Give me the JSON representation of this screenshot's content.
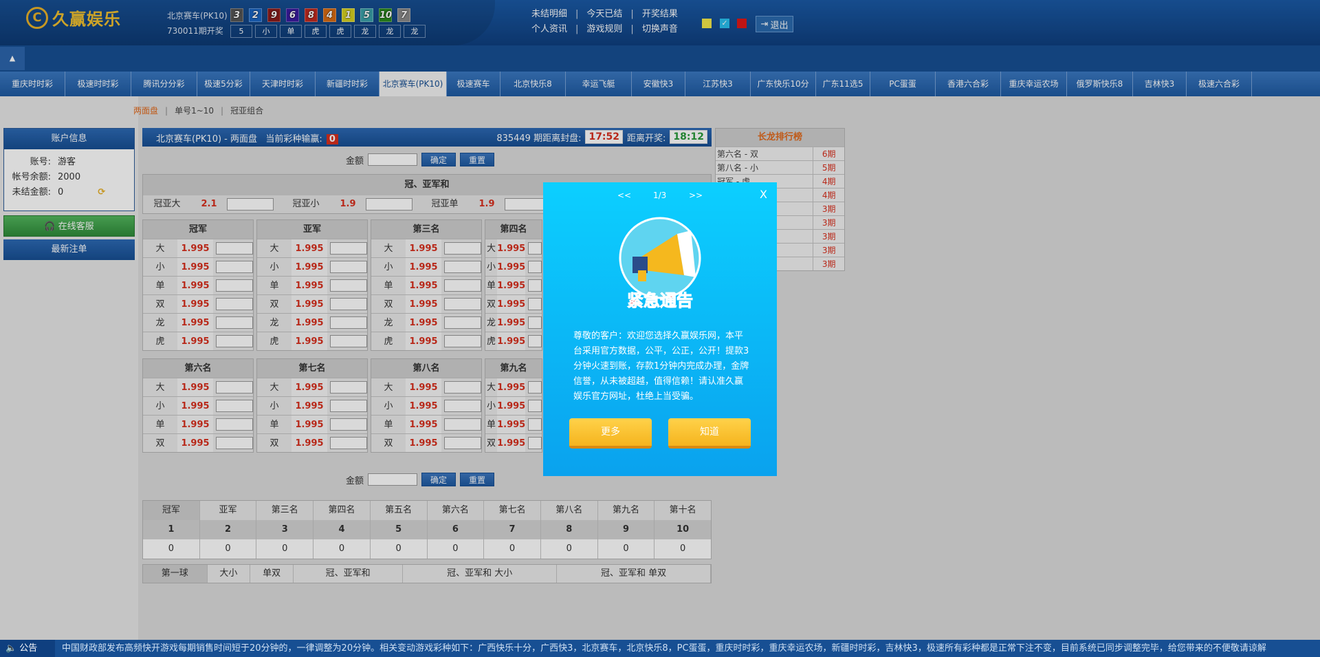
{
  "header": {
    "logo_text": "久赢娱乐",
    "lottery_name": "北京赛车(PK10)",
    "issue": "730011期开奖",
    "balls": [
      {
        "n": "3",
        "c": "#555555"
      },
      {
        "n": "2",
        "c": "#1a66c4"
      },
      {
        "n": "9",
        "c": "#8a1a1a"
      },
      {
        "n": "6",
        "c": "#3a1aa0"
      },
      {
        "n": "8",
        "c": "#c0281e"
      },
      {
        "n": "4",
        "c": "#d86a12"
      },
      {
        "n": "1",
        "c": "#d6d020"
      },
      {
        "n": "5",
        "c": "#3aa0a8"
      },
      {
        "n": "10",
        "c": "#2a8a1e"
      },
      {
        "n": "7",
        "c": "#8a8a8a"
      }
    ],
    "cells": [
      "5",
      "小",
      "单",
      "虎",
      "虎",
      "龙",
      "龙",
      "龙"
    ],
    "links_row1": [
      "未结明细",
      "今天已结",
      "开奖结果"
    ],
    "links_row2": [
      "个人资讯",
      "游戏规则",
      "切换声音"
    ],
    "logout": "退出"
  },
  "nav": [
    "重庆时时彩",
    "极速时时彩",
    "腾讯分分彩",
    "极速5分彩",
    "天津时时彩",
    "新疆时时彩",
    "北京赛车(PK10)",
    "极速赛车",
    "北京快乐8",
    "幸运飞艇",
    "安徽快3",
    "江苏快3",
    "广东快乐10分",
    "广东11选5",
    "PC蛋蛋",
    "香港六合彩",
    "重庆幸运农场",
    "俄罗斯快乐8",
    "吉林快3",
    "极速六合彩"
  ],
  "breadcrumb": [
    "两面盘",
    "单号1~10",
    "冠亚组合"
  ],
  "account": {
    "title": "账户信息",
    "rows": [
      {
        "k": "账号:",
        "v": "游客"
      },
      {
        "k": "帐号余额:",
        "v": "2000"
      },
      {
        "k": "未结金额:",
        "v": "0"
      }
    ],
    "service": "在线客服",
    "latest": "最新注单"
  },
  "main": {
    "title": "北京赛车(PK10) - 两面盘",
    "profit_label": "当前彩种输赢:",
    "profit": "0",
    "issue_text": "835449 期距离封盘:",
    "close_time": "17:52",
    "open_label": "距离开奖:",
    "open_time": "18:12",
    "amount_label": "金额",
    "confirm": "确定",
    "reset": "重置",
    "gyh_title": "冠、亚军和",
    "gyh": [
      {
        "k": "冠亚大",
        "v": "2.1"
      },
      {
        "k": "冠亚小",
        "v": "1.9"
      },
      {
        "k": "冠亚单",
        "v": "1.9"
      }
    ],
    "boxes1": [
      {
        "t": "冠军"
      },
      {
        "t": "亚军"
      },
      {
        "t": "第三名"
      },
      {
        "t": "第四名"
      }
    ],
    "rows1": [
      "大",
      "小",
      "单",
      "双",
      "龙",
      "虎"
    ],
    "boxes2": [
      {
        "t": "第六名"
      },
      {
        "t": "第七名"
      },
      {
        "t": "第八名"
      },
      {
        "t": "第九名"
      }
    ],
    "rows2": [
      "大",
      "小",
      "单",
      "双"
    ],
    "odd": "1.995",
    "stat_head": [
      "冠军",
      "亚军",
      "第三名",
      "第四名",
      "第五名",
      "第六名",
      "第七名",
      "第八名",
      "第九名",
      "第十名"
    ],
    "stat_nums": [
      "1",
      "2",
      "3",
      "4",
      "5",
      "6",
      "7",
      "8",
      "9",
      "10"
    ],
    "stat_vals": [
      "0",
      "0",
      "0",
      "0",
      "0",
      "0",
      "0",
      "0",
      "0",
      "0"
    ],
    "tabs": [
      "第一球",
      "大小",
      "单双",
      "冠、亚军和",
      "冠、亚军和 大小",
      "冠、亚军和 单双"
    ]
  },
  "changlong": {
    "title": "长龙排行榜",
    "rows": [
      {
        "k": "第六名 - 双",
        "v": "6期"
      },
      {
        "k": "第八名 - 小",
        "v": "5期"
      },
      {
        "k": "冠军 - 虎",
        "v": "4期"
      },
      {
        "k": "",
        "v": "4期"
      },
      {
        "k": "",
        "v": "3期"
      },
      {
        "k": "",
        "v": "3期"
      },
      {
        "k": "",
        "v": "3期"
      },
      {
        "k": "",
        "v": "3期"
      },
      {
        "k": "",
        "v": "3期"
      }
    ]
  },
  "modal": {
    "prev": "<<",
    "page": "1/3",
    "next": ">>",
    "close": "X",
    "headline": "紧急通告",
    "text": "尊敬的客户：欢迎您选择久赢娱乐网，本平台采用官方数据，公平，公正，公开！提款3分钟火速到账，存款1分钟内完成办理，金牌信誉，从未被超越，值得信赖！请认准久赢娱乐官方网址，杜绝上当受骗。",
    "more": "更多",
    "ok": "知道"
  },
  "footer": {
    "label": "公告",
    "text": "中国财政部发布高频快开游戏每期销售时间短于20分钟的，一律调整为20分钟。相关变动游戏彩种如下：广西快乐十分，广西快3，北京赛车，北京快乐8，PC蛋蛋，重庆时时彩，重庆幸运农场，新疆时时彩，吉林快3，极速所有彩种都是正常下注不变，目前系统已同步调整完毕，给您带来的不便敬请谅解"
  },
  "colors": {
    "accent": "#174f93",
    "odd_red": "#d9301e",
    "sq1": "#f4e84a",
    "sq2": "#28c0f0",
    "sq3": "#e01818"
  }
}
